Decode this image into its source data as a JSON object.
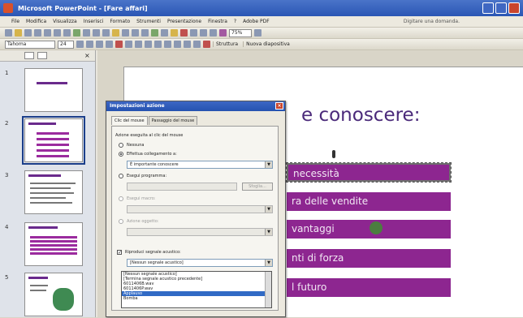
{
  "window": {
    "title": "Microsoft PowerPoint - [Fare affari]"
  },
  "menu": {
    "items": [
      "File",
      "Modifica",
      "Visualizza",
      "Inserisci",
      "Formato",
      "Strumenti",
      "Presentazione",
      "Finestra",
      "?",
      "Adobe PDF"
    ],
    "help_placeholder": "Digitare una domanda."
  },
  "toolbar": {
    "zoom": "75%",
    "font": "Tahoma",
    "size": "24",
    "design_label": "Struttura",
    "new_slide_label": "Nuova diapositiva"
  },
  "thumbnails": [
    {
      "num": "1"
    },
    {
      "num": "2"
    },
    {
      "num": "3"
    },
    {
      "num": "4"
    },
    {
      "num": "5"
    }
  ],
  "slide": {
    "title": "e conoscere:",
    "bars": [
      "necessità",
      "ra delle vendite",
      "vantaggi",
      "nti di forza",
      "l futuro"
    ]
  },
  "dialog": {
    "title": "Impostazioni azione",
    "tabs": [
      "Clic del mouse",
      "Passaggio del mouse"
    ],
    "group_label": "Azione eseguita al clic del mouse",
    "opt_none": "Nessuna",
    "opt_hyperlink": "Effettua collegamento a:",
    "hyperlink_value": "È importante conoscere",
    "opt_run_program": "Esegui programma:",
    "browse_label": "Sfoglia...",
    "opt_run_macro": "Esegui macro:",
    "opt_object_action": "Azione oggetto:",
    "play_sound_label": "Riproduci segnale acustico:",
    "sound_value": "[Nessun segnale acustico]",
    "sound_options": [
      "[Nessun segnale acustico]",
      "[Termina segnale acustico precedente]",
      "6011406B.wav",
      "6011406P.wav",
      "Applauso",
      "Bomba"
    ],
    "highlighted_option_index": 4
  }
}
